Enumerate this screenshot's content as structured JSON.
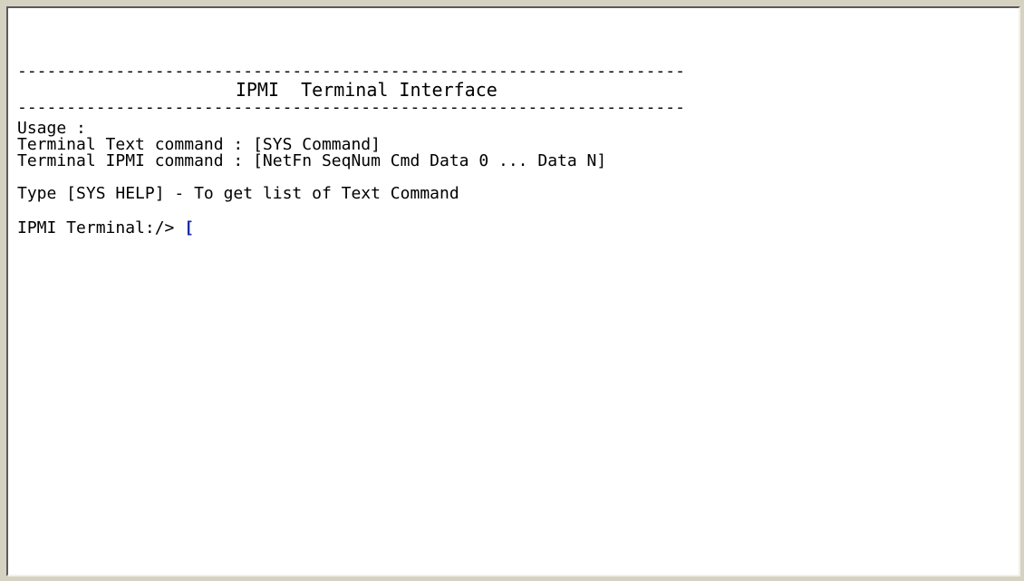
{
  "terminal": {
    "dashes_top": "--------------------------------------------------------------------",
    "title": "                    IPMI  Terminal Interface",
    "dashes_bottom": "--------------------------------------------------------------------",
    "usage_label": "Usage :",
    "text_command_line": "Terminal Text command : [SYS Command]",
    "ipmi_command_line": "Terminal IPMI command : [NetFn SeqNum Cmd Data 0 ... Data N]",
    "help_line": "Type [SYS HELP] - To get list of Text Command",
    "prompt": "IPMI Terminal:/> ",
    "input_value": "[",
    "cursor_color": "#1a2aa8"
  }
}
